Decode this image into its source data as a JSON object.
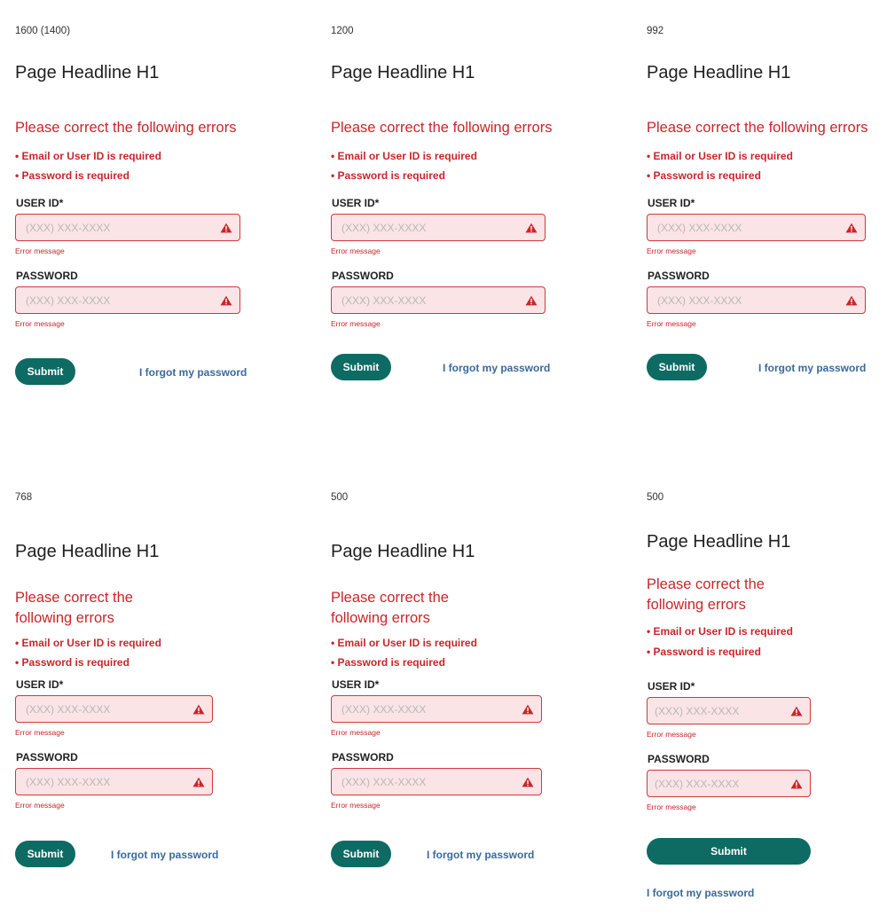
{
  "panels": [
    {
      "breakpoint": "1600 (1400)",
      "headline": "Page Headline H1",
      "error_title": [
        "Please correct the following errors"
      ],
      "errors": [
        "• Email or User ID is required",
        "• Password is required"
      ],
      "user_id_label": "USER ID*",
      "user_id_placeholder": "(XXX) XXX-XXXX",
      "user_id_error": "Error message",
      "password_label": "PASSWORD",
      "password_placeholder": "(XXX) XXX-XXXX",
      "password_error": "Error message",
      "submit_label": "Submit",
      "forgot_label": "I forgot my password"
    },
    {
      "breakpoint": "1200",
      "headline": "Page Headline H1",
      "error_title": [
        "Please correct the following errors"
      ],
      "errors": [
        "• Email or User ID is required",
        "• Password is required"
      ],
      "user_id_label": "USER ID*",
      "user_id_placeholder": "(XXX) XXX-XXXX",
      "user_id_error": "Error message",
      "password_label": "PASSWORD",
      "password_placeholder": "(XXX) XXX-XXXX",
      "password_error": "Error message",
      "submit_label": "Submit",
      "forgot_label": "I forgot my password"
    },
    {
      "breakpoint": "992",
      "headline": "Page Headline H1",
      "error_title": [
        "Please correct the following errors"
      ],
      "errors": [
        "• Email or User ID is required",
        "• Password is required"
      ],
      "user_id_label": "USER ID*",
      "user_id_placeholder": "(XXX) XXX-XXXX",
      "user_id_error": "Error message",
      "password_label": "PASSWORD",
      "password_placeholder": "(XXX) XXX-XXXX",
      "password_error": "Error message",
      "submit_label": "Submit",
      "forgot_label": "I forgot my password"
    },
    {
      "breakpoint": "768",
      "headline": "Page Headline H1",
      "error_title": [
        "Please correct the",
        "following errors"
      ],
      "errors": [
        "• Email or User ID is required",
        "• Password is required"
      ],
      "user_id_label": "USER ID*",
      "user_id_placeholder": "(XXX) XXX-XXXX",
      "user_id_error": "Error message",
      "password_label": "PASSWORD",
      "password_placeholder": "(XXX) XXX-XXXX",
      "password_error": "Error message",
      "submit_label": "Submit",
      "forgot_label": "I forgot my password"
    },
    {
      "breakpoint": "500",
      "headline": "Page Headline H1",
      "error_title": [
        "Please correct the",
        "following errors"
      ],
      "errors": [
        "• Email or User ID is required",
        "• Password is required"
      ],
      "user_id_label": "USER ID*",
      "user_id_placeholder": "(XXX) XXX-XXXX",
      "user_id_error": "Error message",
      "password_label": "PASSWORD",
      "password_placeholder": "(XXX) XXX-XXXX",
      "password_error": "Error message",
      "submit_label": "Submit",
      "forgot_label": "I forgot my password"
    },
    {
      "breakpoint": "500",
      "headline": "Page Headline H1",
      "error_title": [
        "Please correct the",
        "following errors"
      ],
      "errors": [
        "• Email or User ID is required",
        "• Password is required"
      ],
      "user_id_label": "USER ID*",
      "user_id_placeholder": "(XXX) XXX-XXXX",
      "user_id_error": "Error message",
      "password_label": "PASSWORD",
      "password_placeholder": "(XXX) XXX-XXXX",
      "password_error": "Error message",
      "submit_label": "Submit",
      "forgot_label": "I forgot my password"
    }
  ],
  "colors": {
    "error_red": "#c8262b",
    "field_bg": "#fbe4e6",
    "submit_green": "#0d6b63",
    "link_blue": "#3a6a9c"
  },
  "icons": {
    "field_warning": "warning-triangle-icon"
  }
}
